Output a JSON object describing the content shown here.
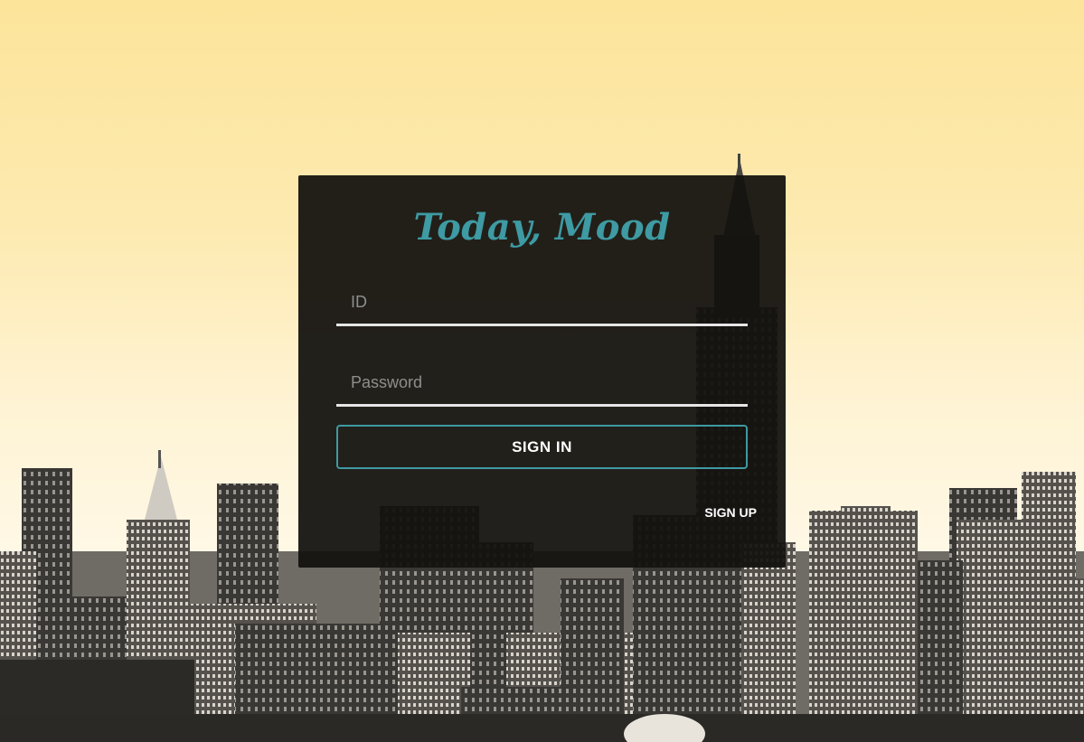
{
  "app": {
    "title": "Today, Mood"
  },
  "login": {
    "id_placeholder": "ID",
    "password_placeholder": "Password",
    "signin_label": "SIGN IN",
    "signup_label": "SIGN UP"
  },
  "colors": {
    "accent": "#3e9aa3",
    "card_background": "#14120f",
    "sky_top": "#fce49a",
    "sky_bottom": "#fff8e6"
  }
}
